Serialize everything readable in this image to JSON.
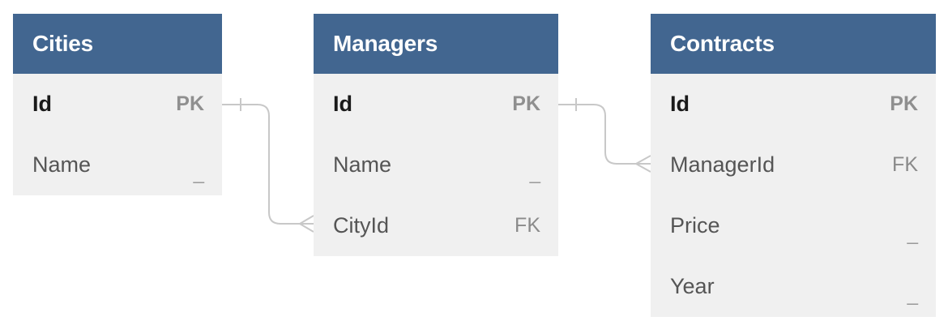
{
  "tables": {
    "cities": {
      "title": "Cities",
      "rows": [
        {
          "name": "Id",
          "key": "PK"
        },
        {
          "name": "Name",
          "key": "_"
        }
      ]
    },
    "managers": {
      "title": "Managers",
      "rows": [
        {
          "name": "Id",
          "key": "PK"
        },
        {
          "name": "Name",
          "key": "_"
        },
        {
          "name": "CityId",
          "key": "FK"
        }
      ]
    },
    "contracts": {
      "title": "Contracts",
      "rows": [
        {
          "name": "Id",
          "key": "PK"
        },
        {
          "name": "ManagerId",
          "key": "FK"
        },
        {
          "name": "Price",
          "key": "_"
        },
        {
          "name": "Year",
          "key": "_"
        }
      ]
    }
  },
  "relationships": [
    {
      "from": "Cities.Id",
      "to": "Managers.CityId",
      "cardinality": "one-to-many"
    },
    {
      "from": "Managers.Id",
      "to": "Contracts.ManagerId",
      "cardinality": "one-to-many"
    }
  ],
  "colors": {
    "header": "#426690",
    "body": "#f0f0f0",
    "connector": "#c8c8c8"
  }
}
